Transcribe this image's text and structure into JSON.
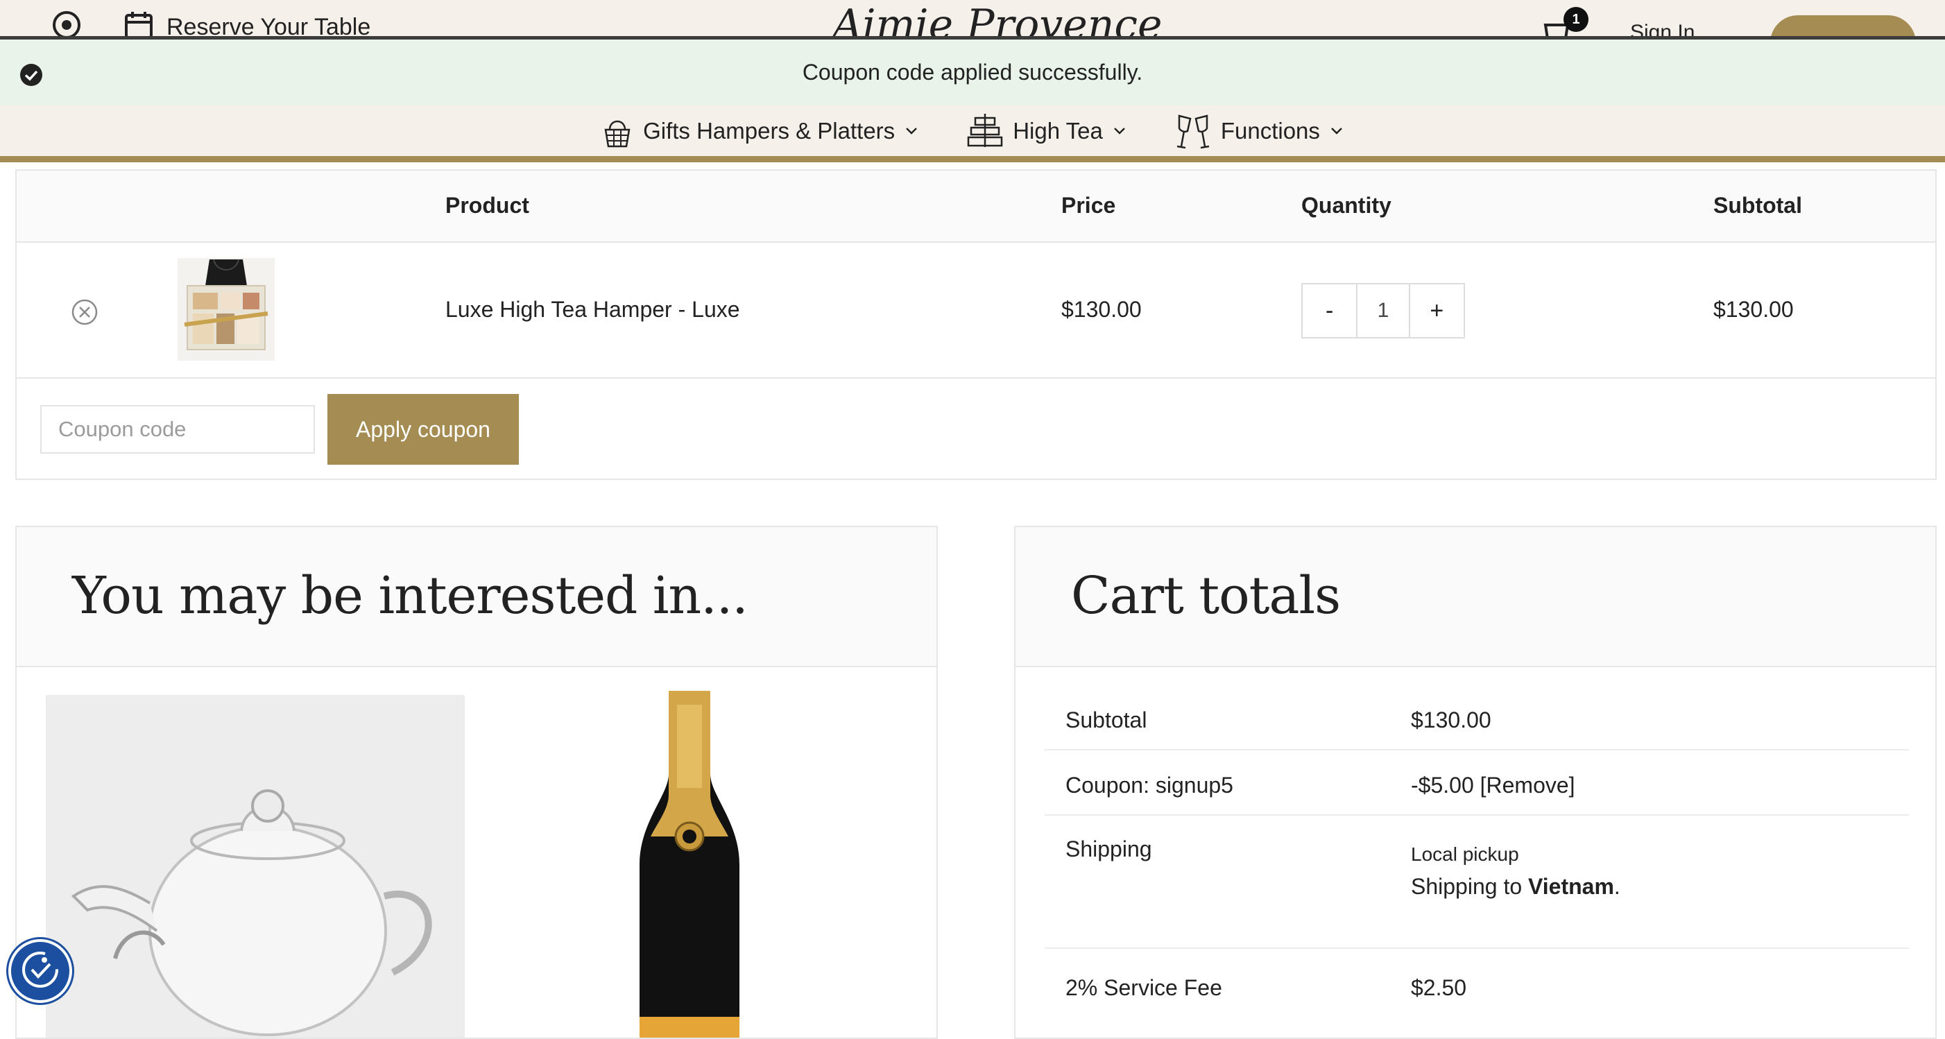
{
  "header": {
    "reserve_label": "Reserve Your Table",
    "logo_text": "Aimie Provence",
    "cart_count": "1",
    "signin_label": "Sign In"
  },
  "notice": {
    "message": "Coupon code applied successfully."
  },
  "nav": {
    "items": [
      {
        "label": "Gifts Hampers & Platters",
        "icon": "gift-basket-icon"
      },
      {
        "label": "High Tea",
        "icon": "cake-stand-icon"
      },
      {
        "label": "Functions",
        "icon": "champagne-glasses-icon"
      }
    ]
  },
  "cart_table": {
    "headers": {
      "product": "Product",
      "price": "Price",
      "quantity": "Quantity",
      "subtotal": "Subtotal"
    },
    "rows": [
      {
        "product_name": "Luxe High Tea Hamper - Luxe",
        "price": "$130.00",
        "quantity": "1",
        "subtotal": "$130.00"
      }
    ],
    "qty_minus": "-",
    "qty_plus": "+",
    "coupon_placeholder": "Coupon code",
    "apply_label": "Apply coupon"
  },
  "interested": {
    "title": "You may be interested in..."
  },
  "totals": {
    "title": "Cart totals",
    "subtotal_label": "Subtotal",
    "subtotal_value": "$130.00",
    "coupon_label": "Coupon: signup5",
    "coupon_value": "-$5.00",
    "coupon_remove": "[Remove]",
    "shipping_label": "Shipping",
    "shipping_method": "Local pickup",
    "shipping_to_prefix": "Shipping to",
    "shipping_country": "Vietnam",
    "shipping_suffix": ".",
    "service_fee_label": "2% Service Fee",
    "service_fee_value": "$2.50"
  },
  "colors": {
    "accent": "#a48c52",
    "notice_bg": "#e9f3ea",
    "header_bg": "#f6f0ea",
    "a11y_blue": "#1d4fa0"
  }
}
